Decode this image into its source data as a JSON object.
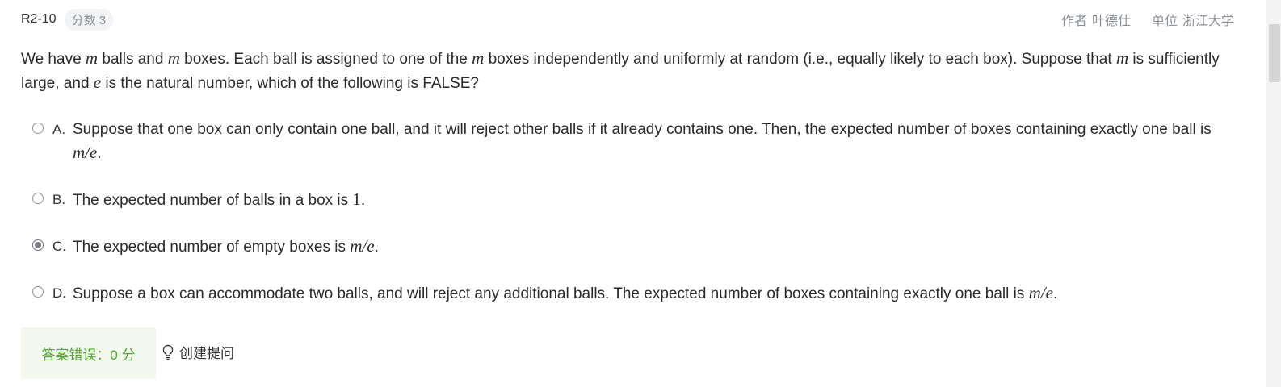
{
  "header": {
    "question_id": "R2-10",
    "score_badge": "分数 3",
    "author_label": "作者",
    "author_name": "叶德仕",
    "unit_label": "单位",
    "unit_name": "浙江大学"
  },
  "question": {
    "p1": "We have ",
    "m1": "m",
    "p2": " balls and ",
    "m2": "m",
    "p3": " boxes. Each ball is assigned to one of the ",
    "m3": "m",
    "p4": " boxes independently and uniformly at random (i.e., equally likely to each box). Suppose that ",
    "m4": "m",
    "p5": " is sufficiently large, and ",
    "m5": "e",
    "p6": " is the natural number, which of the following is FALSE?"
  },
  "options": [
    {
      "letter": "A.",
      "text": "Suppose that one box can only contain one ball, and it will reject other balls if it already contains one. Then, the expected number of boxes containing exactly one ball is ",
      "math": "m/e",
      "tail": ".",
      "selected": false
    },
    {
      "letter": "B.",
      "text": "The expected number of balls in a box is ",
      "math": "1",
      "tail": ".",
      "selected": false
    },
    {
      "letter": "C.",
      "text": "The expected number of empty boxes is ",
      "math": "m/e",
      "tail": ".",
      "selected": true
    },
    {
      "letter": "D.",
      "text": "Suppose a box can accommodate two balls, and will reject any additional balls. The expected number of boxes containing exactly one ball is ",
      "math": "m/e",
      "tail": ".",
      "selected": false
    }
  ],
  "footer": {
    "result": "答案错误：0 分",
    "create_hint": "创建提问",
    "hint_icon": "lightbulb-icon"
  },
  "colors": {
    "result_text": "#52a832",
    "result_bg": "#f2f8ee",
    "muted": "#8a8f96"
  }
}
